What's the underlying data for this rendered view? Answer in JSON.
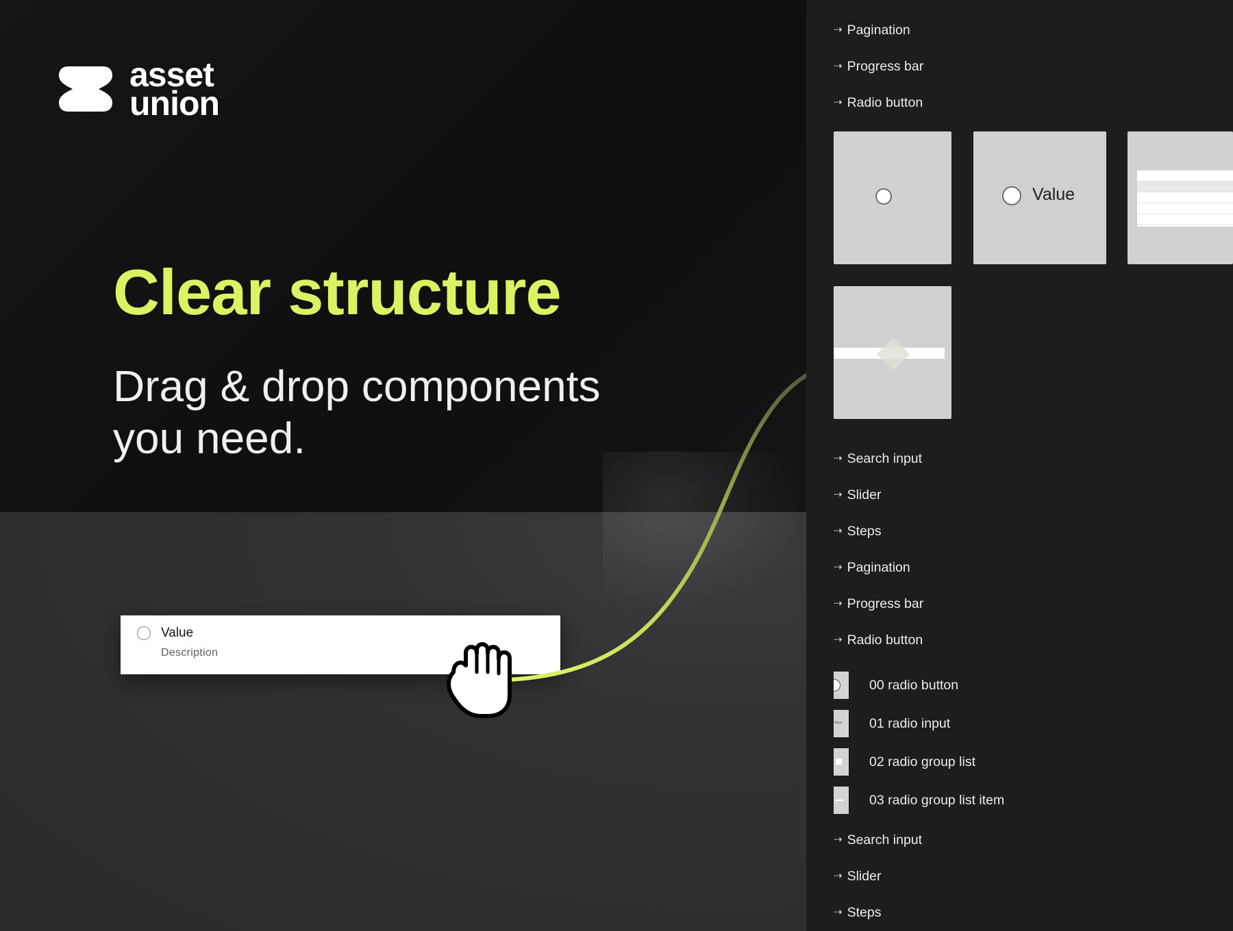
{
  "brand": {
    "name_line1": "asset",
    "name_line2": "union"
  },
  "hero": {
    "headline": "Clear structure",
    "subhead_line1": "Drag & drop components",
    "subhead_line2": "you need."
  },
  "dragged_component": {
    "value": "Value",
    "description": "Description"
  },
  "panel": {
    "arrow_glyph": "⇢",
    "top_items": [
      "Pagination",
      "Progress bar",
      "Radio button"
    ],
    "thumbnails": [
      {
        "name": "radio-circle-thumbnail"
      },
      {
        "name": "radio-value-thumbnail",
        "label": "Value"
      },
      {
        "name": "radio-group-list-thumbnail"
      },
      {
        "name": "radio-group-list-item-thumbnail"
      }
    ],
    "middle_items": [
      "Search input",
      "Slider",
      "Steps",
      "Pagination",
      "Progress bar",
      "Radio button"
    ],
    "layers": [
      {
        "label": "00 radio button",
        "icon": "radio-circle-icon"
      },
      {
        "label": "01 radio input",
        "icon": "radio-input-icon",
        "tiny": "Value"
      },
      {
        "label": "02 radio group list",
        "icon": "radio-group-icon"
      },
      {
        "label": "03 radio group list item",
        "icon": "radio-item-icon"
      }
    ],
    "bottom_items": [
      "Search input",
      "Slider",
      "Steps"
    ]
  },
  "colors": {
    "accent": "#dcf263",
    "background": "#141414",
    "panel": "#1d1d1e"
  }
}
